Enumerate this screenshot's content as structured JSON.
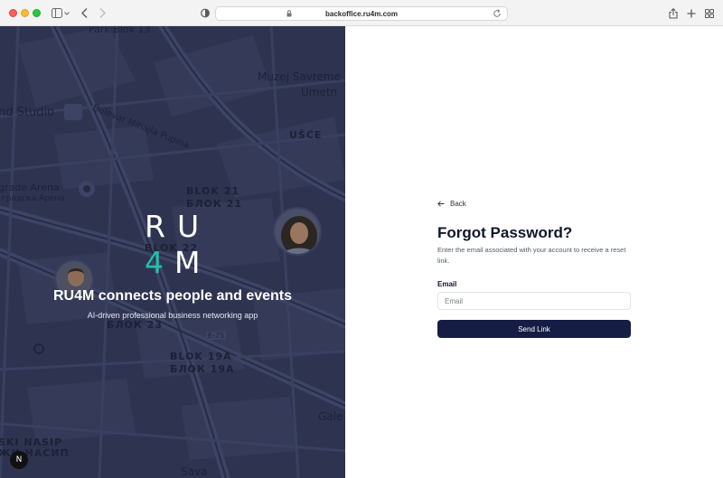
{
  "browser": {
    "url": "backoffice.ru4m.com",
    "icons": [
      "sidebar-icon",
      "chevron-down-icon",
      "back-arrow-icon",
      "forward-arrow-icon",
      "shield-icon",
      "lock-icon",
      "reload-icon",
      "share-icon",
      "plus-icon",
      "tabs-grid-icon"
    ]
  },
  "hero": {
    "map_labels": {
      "park_blok": "Park Blok 13",
      "bulevar": "Bulevar Mihajla Pupina",
      "muzej1": "Muzej Savreme",
      "muzej2": "Umetn",
      "studio": "nd Studio",
      "usce": "UŠĆE",
      "arena1": "grade Arena",
      "arena2": "градска Арена",
      "blok21a": "BLOK 21",
      "blok21b": "БЛОК 21",
      "blok22": "BLOK 22",
      "blok23": "БЛОК 23",
      "blok19a": "BLOK 19A",
      "blok19b": "БЛОК 19A",
      "e75": "E-75",
      "nasip1": "SKI NASIP",
      "nasip2": "ЖИ НАСИП",
      "gale": "Gale",
      "sava": "Sava"
    },
    "logo": {
      "r": "R",
      "u": "U",
      "four": "4",
      "m": "M",
      "accent": "#22c0a8"
    },
    "title": "RU4M connects people and events",
    "subtitle": "AI-driven professional business networking app",
    "badge": "N",
    "background": "#2e3450"
  },
  "form": {
    "back_label": "Back",
    "title": "Forgot Password?",
    "description": "Enter the email associated with your account to receive a reset link.",
    "email_label": "Email",
    "email_placeholder": "Email",
    "email_value": "",
    "submit_label": "Send Link",
    "button_color": "#151d45"
  }
}
